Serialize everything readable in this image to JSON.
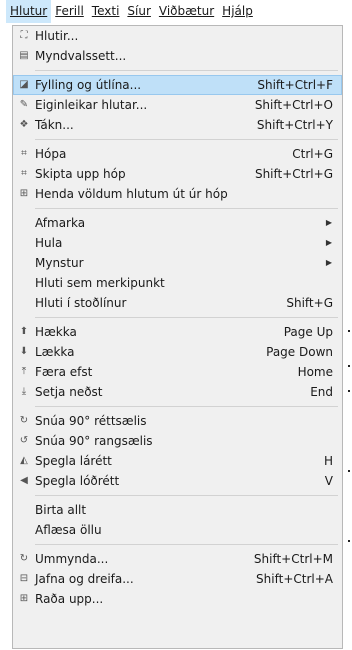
{
  "menubar": [
    {
      "label": "Hlutur",
      "active": true
    },
    {
      "label": "Ferill",
      "active": false
    },
    {
      "label": "Texti",
      "active": false
    },
    {
      "label": "Síur",
      "active": false
    },
    {
      "label": "Viðbætur",
      "active": false
    },
    {
      "label": "Hjálp",
      "active": false
    }
  ],
  "menu": {
    "items": [
      {
        "label": "Hlutir...",
        "shortcut": "",
        "icon": "objects-icon",
        "glyph": "⛶"
      },
      {
        "label": "Myndvalssett...",
        "shortcut": "",
        "icon": "selectors-icon",
        "glyph": "▤"
      },
      {
        "sep": true
      },
      {
        "label": "Fylling og útlína...",
        "shortcut": "Shift+Ctrl+F",
        "icon": "fill-stroke-icon",
        "glyph": "◪",
        "highlight": true
      },
      {
        "label": "Eiginleikar hlutar...",
        "shortcut": "Shift+Ctrl+O",
        "icon": "object-properties-icon",
        "glyph": "✎"
      },
      {
        "label": "Tákn...",
        "shortcut": "Shift+Ctrl+Y",
        "icon": "symbols-icon",
        "glyph": "❖"
      },
      {
        "sep": true
      },
      {
        "label": "Hópa",
        "shortcut": "Ctrl+G",
        "icon": "group-icon",
        "glyph": "⌗"
      },
      {
        "label": "Skipta upp hóp",
        "shortcut": "Shift+Ctrl+G",
        "icon": "ungroup-icon",
        "glyph": "⌗"
      },
      {
        "label": "Henda völdum hlutum út úr hóp",
        "shortcut": "",
        "icon": "pop-from-group-icon",
        "glyph": "⊞"
      },
      {
        "sep": true
      },
      {
        "label": "Afmarka",
        "shortcut": "",
        "submenu": true,
        "icon": "",
        "glyph": ""
      },
      {
        "label": "Hula",
        "shortcut": "",
        "submenu": true,
        "icon": "",
        "glyph": ""
      },
      {
        "label": "Mynstur",
        "shortcut": "",
        "submenu": true,
        "icon": "",
        "glyph": ""
      },
      {
        "label": "Hluti sem merkipunkt",
        "shortcut": "",
        "icon": "",
        "glyph": ""
      },
      {
        "label": "Hluti í stoðlínur",
        "shortcut": "Shift+G",
        "icon": "",
        "glyph": ""
      },
      {
        "sep": true
      },
      {
        "label": "Hækka",
        "shortcut": "Page Up",
        "icon": "raise-icon",
        "glyph": "⬆"
      },
      {
        "label": "Lækka",
        "shortcut": "Page Down",
        "icon": "lower-icon",
        "glyph": "⬇"
      },
      {
        "label": "Færa efst",
        "shortcut": "Home",
        "icon": "raise-to-top-icon",
        "glyph": "⤒"
      },
      {
        "label": "Setja neðst",
        "shortcut": "End",
        "icon": "lower-to-bottom-icon",
        "glyph": "⤓"
      },
      {
        "sep": true
      },
      {
        "label": "Snúa 90° réttsælis",
        "shortcut": "",
        "icon": "rotate-cw-icon",
        "glyph": "↻"
      },
      {
        "label": "Snúa 90° rangsælis",
        "shortcut": "",
        "icon": "rotate-ccw-icon",
        "glyph": "↺"
      },
      {
        "label": "Spegla lárétt",
        "shortcut": "H",
        "icon": "flip-horizontal-icon",
        "glyph": "◭"
      },
      {
        "label": "Spegla lóðrétt",
        "shortcut": "V",
        "icon": "flip-vertical-icon",
        "glyph": "◀"
      },
      {
        "sep": true
      },
      {
        "label": "Birta allt",
        "shortcut": "",
        "icon": "",
        "glyph": ""
      },
      {
        "label": "Aflæsa öllu",
        "shortcut": "",
        "icon": "",
        "glyph": ""
      },
      {
        "sep": true
      },
      {
        "label": "Ummynda...",
        "shortcut": "Shift+Ctrl+M",
        "icon": "transform-icon",
        "glyph": "↻"
      },
      {
        "label": "Jafna og dreifa...",
        "shortcut": "Shift+Ctrl+A",
        "icon": "align-distribute-icon",
        "glyph": "⊟"
      },
      {
        "label": "Raða upp...",
        "shortcut": "",
        "icon": "arrange-icon",
        "glyph": "⊞"
      }
    ]
  }
}
